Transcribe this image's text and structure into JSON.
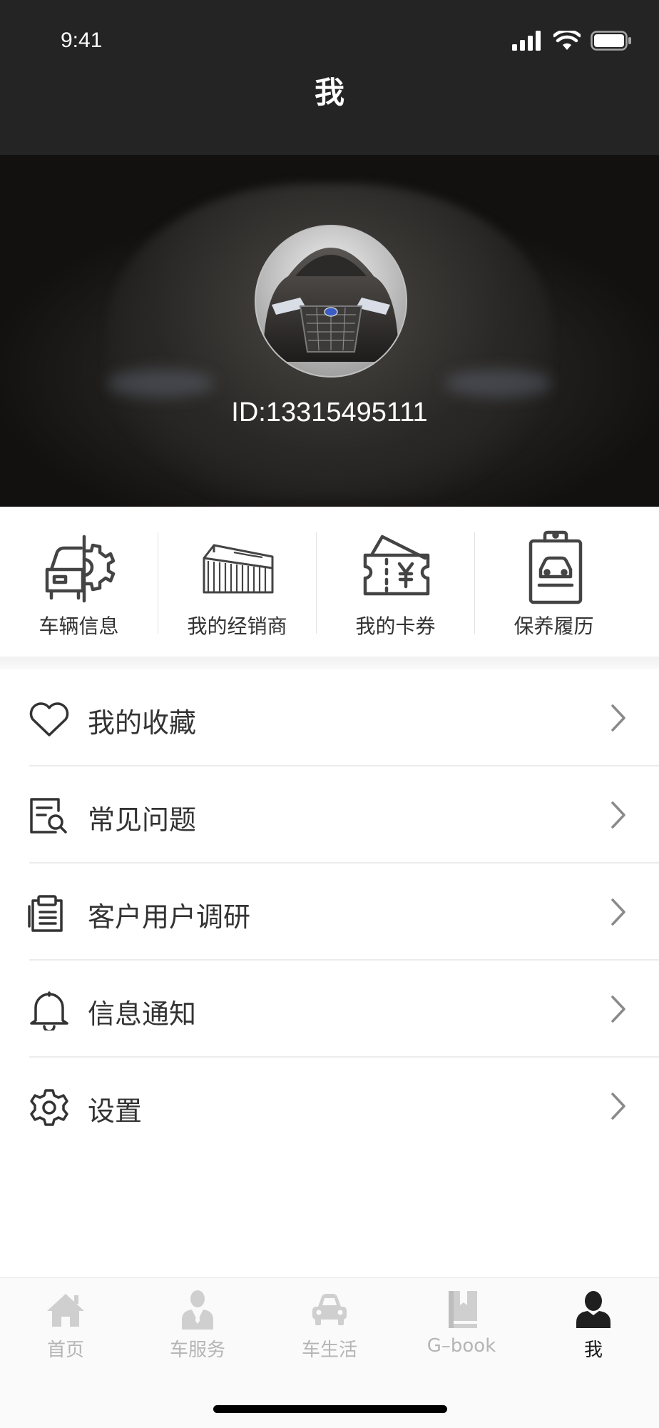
{
  "status_bar": {
    "time": "9:41"
  },
  "nav": {
    "title": "我"
  },
  "profile": {
    "id_text": "ID:13315495111"
  },
  "quick_menu": [
    {
      "label": "车辆信息",
      "icon": "car-gear-icon"
    },
    {
      "label": "我的经销商",
      "icon": "dealership-building-icon"
    },
    {
      "label": "我的卡券",
      "icon": "coupon-ticket-icon"
    },
    {
      "label": "保养履历",
      "icon": "maintenance-clipboard-icon"
    }
  ],
  "menu": [
    {
      "label": "我的收藏",
      "icon": "heart-icon"
    },
    {
      "label": "常见问题",
      "icon": "document-search-icon"
    },
    {
      "label": "客户用户调研",
      "icon": "survey-clipboard-icon"
    },
    {
      "label": "信息通知",
      "icon": "bell-icon"
    },
    {
      "label": "设置",
      "icon": "gear-icon"
    }
  ],
  "tabbar": [
    {
      "label": "首页",
      "icon": "home-icon",
      "active": false
    },
    {
      "label": "车服务",
      "icon": "service-person-icon",
      "active": false
    },
    {
      "label": "车生活",
      "icon": "car-icon",
      "active": false
    },
    {
      "label": "G–book",
      "icon": "book-icon",
      "active": false
    },
    {
      "label": "我",
      "icon": "user-icon",
      "active": true
    }
  ],
  "colors": {
    "nav_bg": "#242424",
    "tab_inactive": "#b5b5b5",
    "tab_active": "#1a1a1a"
  }
}
